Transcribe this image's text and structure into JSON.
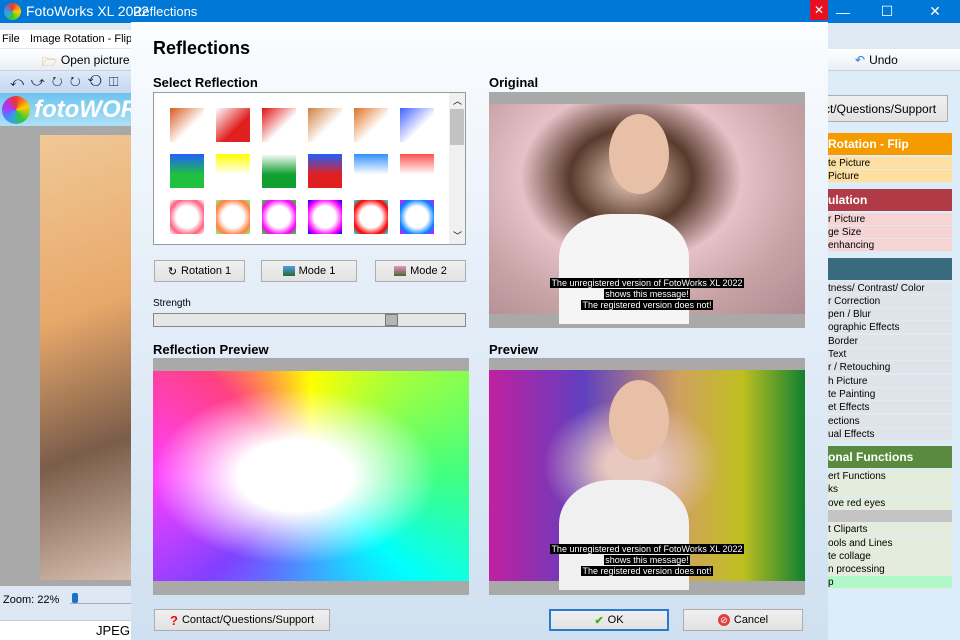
{
  "app": {
    "title": "FotoWorks XL 2022",
    "logo_text": "fotoWOR",
    "menu": [
      "File",
      "Image Rotation - Flip"
    ],
    "toolbar": {
      "open": "Open picture",
      "undo": "Undo"
    },
    "zoom_label": "Zoom: 22%",
    "status_format": "JPEG"
  },
  "right_panel": {
    "support_button": "ct/Questions/Support",
    "sections": [
      {
        "title": "Rotation - Flip",
        "color": "#f59b00",
        "item_bg": "#fde0a0",
        "items": [
          "te Picture",
          "Picture"
        ]
      },
      {
        "title": "ulation",
        "color": "#b03a46",
        "item_bg": "#f4d4d4",
        "items": [
          "r Picture",
          "ge Size",
          "enhancing"
        ]
      },
      {
        "title": "",
        "color": "#3a6a7e",
        "item_bg": "#dfe4ea",
        "items": [
          "tness/ Contrast/ Color",
          "r Correction",
          "pen / Blur",
          "ographic Effects",
          "Border",
          "Text",
          "r / Retouching",
          "h Picture",
          "te Painting",
          "et Effects",
          "ections",
          "ual Effects"
        ]
      },
      {
        "title": "onal Functions",
        "color": "#5a8a3e",
        "item_bg": "#e4ecdc",
        "items": [
          "ert Functions",
          "ks",
          "ove red eyes",
          "",
          "t Cliparts",
          "ools and Lines",
          "te collage",
          "n processing"
        ]
      }
    ],
    "extra_item": "p"
  },
  "dialog": {
    "window_title": "Reflections",
    "heading": "Reflections",
    "select_heading": "Select Reflection",
    "thumbnails": [
      [
        "#d85a20",
        "#ffffff"
      ],
      [
        "#ffffff",
        "#e02020"
      ],
      [
        "#e01010",
        "#ffffff"
      ],
      [
        "#d08040",
        "#ffffff"
      ],
      [
        "#e07020",
        "#ffffff"
      ],
      [
        "#4060ff",
        "#ffffff"
      ],
      [
        "#2060ff",
        "#20c040"
      ],
      [
        "#ffff00",
        "#ffffff"
      ],
      [
        "#ffffff",
        "#10a030"
      ],
      [
        "#2060ff",
        "#e02020"
      ],
      [
        "#3090ff",
        "#ffffff"
      ],
      [
        "#ff5050",
        "#ffffff"
      ],
      [
        "#ff6080",
        "#ffffff"
      ],
      [
        "#ff8040",
        "#80ff80"
      ],
      [
        "#ff00ff",
        "#00ff00"
      ],
      [
        "#ff00ff",
        "#0000ff"
      ],
      [
        "#ff0000",
        "#00ffff"
      ],
      [
        "#0080ff",
        "#ff00ff"
      ]
    ],
    "buttons": {
      "rotation": "Rotation 1",
      "mode1": "Mode 1",
      "mode2": "Mode 2",
      "contact": "Contact/Questions/Support",
      "ok": "OK",
      "cancel": "Cancel"
    },
    "strength_label": "Strength",
    "strength_value": 0.77,
    "reflection_preview_heading": "Reflection Preview",
    "original_heading": "Original",
    "preview_heading": "Preview",
    "watermark": [
      "The unregistered version of FotoWorks XL 2022",
      "shows this message!",
      "The registered version does not!"
    ]
  }
}
